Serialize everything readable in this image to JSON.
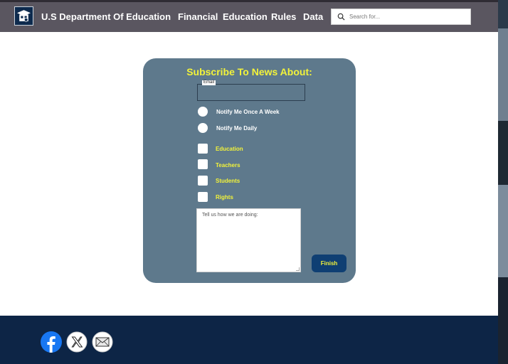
{
  "header": {
    "site_title": "U.S Department Of Education",
    "logo_icon": "graduation-cap-icon",
    "nav": [
      "Financial",
      "Education",
      "Rules",
      "Data"
    ],
    "search": {
      "placeholder": "Search for...",
      "icon": "search-icon"
    }
  },
  "form": {
    "title": "Subscribe To News About:",
    "email_label": "Email",
    "email_value": "",
    "frequency_options": [
      "Notify Me Once A Week",
      "Notify Me Daily"
    ],
    "topics": [
      "Education",
      "Teachers",
      "Students",
      "Rights"
    ],
    "feedback_placeholder": "Tell us how we are doing:",
    "submit_label": "Finish"
  },
  "footer": {
    "social_icons": [
      "facebook-icon",
      "x-twitter-icon",
      "mail-icon"
    ]
  },
  "colors": {
    "header_bg": "#5a5660",
    "card_bg": "#5e798c",
    "accent_yellow": "#f3f33a",
    "footer_bg": "#0d2546",
    "button_bg": "#0f3f73"
  }
}
